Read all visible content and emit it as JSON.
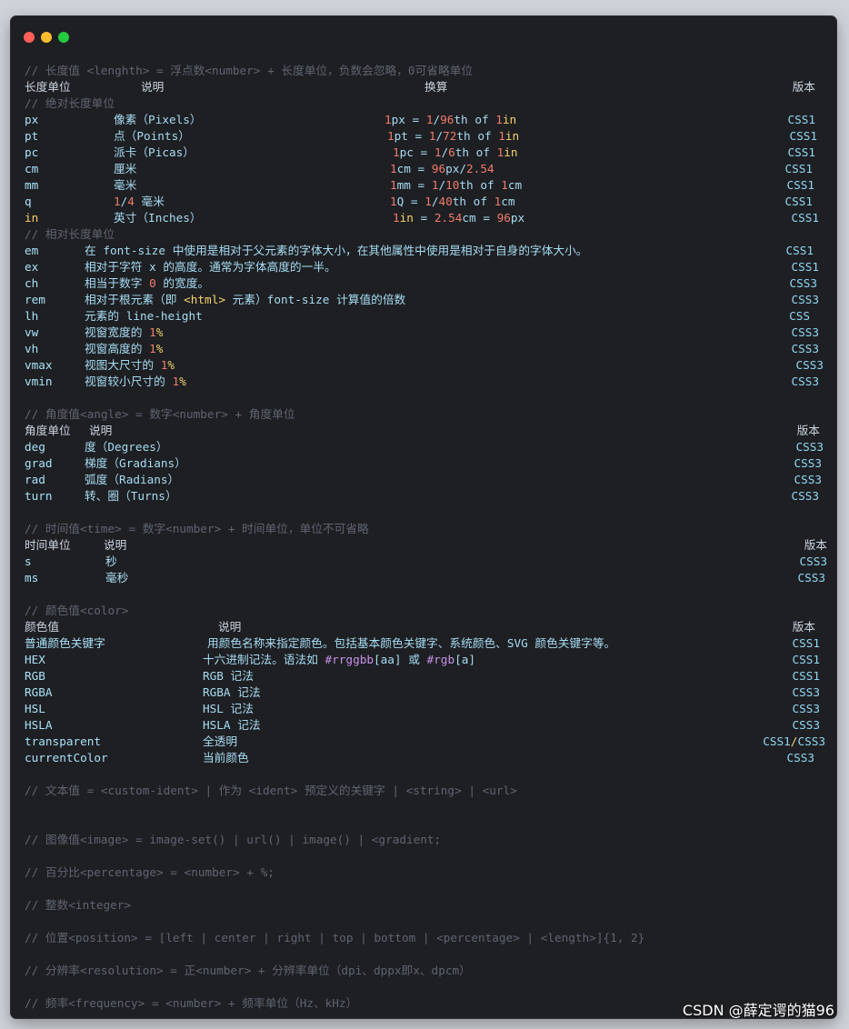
{
  "window": {
    "traffic_lights": [
      {
        "name": "close",
        "color": "#ff5f56"
      },
      {
        "name": "minimize",
        "color": "#ffbd2e"
      },
      {
        "name": "zoom",
        "color": "#27c93f"
      }
    ]
  },
  "length": {
    "comment": "// 长度值 <lenghth> = 浮点数<number> + 长度单位，负数会忽略，0可省略单位",
    "header": {
      "unit": "长度单位",
      "desc": "说明",
      "conv": "换算",
      "version": "版本"
    },
    "abs_comment": "// 绝对长度单位",
    "absolute": [
      {
        "unit": "px",
        "desc": "像素（Pixels）",
        "conv": [
          {
            "t": "1",
            "c": "n"
          },
          {
            "t": "px = ",
            "c": "tx"
          },
          {
            "t": "1",
            "c": "n"
          },
          {
            "t": "/",
            "c": "tx"
          },
          {
            "t": "96",
            "c": "n"
          },
          {
            "t": "th of ",
            "c": "tx"
          },
          {
            "t": "1",
            "c": "n"
          },
          {
            "t": "in",
            "c": "k"
          }
        ],
        "version": "CSS1"
      },
      {
        "unit": "pt",
        "desc": "点（Points）",
        "conv": [
          {
            "t": "1",
            "c": "n"
          },
          {
            "t": "pt = ",
            "c": "tx"
          },
          {
            "t": "1",
            "c": "n"
          },
          {
            "t": "/",
            "c": "tx"
          },
          {
            "t": "72",
            "c": "n"
          },
          {
            "t": "th of ",
            "c": "tx"
          },
          {
            "t": "1",
            "c": "n"
          },
          {
            "t": "in",
            "c": "k"
          }
        ],
        "version": "CSS1"
      },
      {
        "unit": "pc",
        "desc": "派卡（Picas）",
        "conv": [
          {
            "t": "1",
            "c": "n"
          },
          {
            "t": "pc = ",
            "c": "tx"
          },
          {
            "t": "1",
            "c": "n"
          },
          {
            "t": "/",
            "c": "tx"
          },
          {
            "t": "6",
            "c": "n"
          },
          {
            "t": "th of ",
            "c": "tx"
          },
          {
            "t": "1",
            "c": "n"
          },
          {
            "t": "in",
            "c": "k"
          }
        ],
        "version": "CSS1"
      },
      {
        "unit": "cm",
        "desc": "厘米",
        "conv": [
          {
            "t": "1",
            "c": "n"
          },
          {
            "t": "cm = ",
            "c": "tx"
          },
          {
            "t": "96",
            "c": "n"
          },
          {
            "t": "px",
            "c": "tx"
          },
          {
            "t": "/",
            "c": "tx"
          },
          {
            "t": "2.54",
            "c": "n"
          }
        ],
        "version": "CSS1"
      },
      {
        "unit": "mm",
        "desc": "毫米",
        "conv": [
          {
            "t": "1",
            "c": "n"
          },
          {
            "t": "mm = ",
            "c": "tx"
          },
          {
            "t": "1",
            "c": "n"
          },
          {
            "t": "/",
            "c": "tx"
          },
          {
            "t": "10",
            "c": "n"
          },
          {
            "t": "th of ",
            "c": "tx"
          },
          {
            "t": "1",
            "c": "n"
          },
          {
            "t": "cm",
            "c": "tx"
          }
        ],
        "version": "CSS1"
      },
      {
        "unit": "q",
        "desc": [
          {
            "t": "1",
            "c": "n"
          },
          {
            "t": "/",
            "c": "tx"
          },
          {
            "t": "4",
            "c": "n"
          },
          {
            "t": " 毫米",
            "c": "tx"
          }
        ],
        "conv": [
          {
            "t": "1",
            "c": "n"
          },
          {
            "t": "Q = ",
            "c": "tx"
          },
          {
            "t": "1",
            "c": "n"
          },
          {
            "t": "/",
            "c": "tx"
          },
          {
            "t": "40",
            "c": "n"
          },
          {
            "t": "th of ",
            "c": "tx"
          },
          {
            "t": "1",
            "c": "n"
          },
          {
            "t": "cm",
            "c": "tx"
          }
        ],
        "version": "CSS1"
      },
      {
        "unit": "in",
        "unit_class": "k",
        "desc": "英寸（Inches）",
        "conv": [
          {
            "t": "1",
            "c": "n"
          },
          {
            "t": "in",
            "c": "k"
          },
          {
            "t": " = ",
            "c": "tx"
          },
          {
            "t": "2.54",
            "c": "n"
          },
          {
            "t": "cm = ",
            "c": "tx"
          },
          {
            "t": "96",
            "c": "n"
          },
          {
            "t": "px",
            "c": "tx"
          }
        ],
        "version": "CSS1"
      }
    ],
    "rel_comment": "// 相对长度单位",
    "relative": [
      {
        "unit": "em",
        "desc": "在 font-size 中使用是相对于父元素的字体大小，在其他属性中使用是相对于自身的字体大小。",
        "version": "CSS1"
      },
      {
        "unit": "ex",
        "desc": "相对于字符 x 的高度。通常为字体高度的一半。",
        "version": "CSS1"
      },
      {
        "unit": "ch",
        "desc": [
          {
            "t": "相当于数字 ",
            "c": "tx"
          },
          {
            "t": "0",
            "c": "n"
          },
          {
            "t": " 的宽度。",
            "c": "tx"
          }
        ],
        "version": "CSS3"
      },
      {
        "unit": "rem",
        "desc": [
          {
            "t": "相对于根元素（即 ",
            "c": "tx"
          },
          {
            "t": "<html>",
            "c": "k"
          },
          {
            "t": " 元素）font-size 计算值的倍数",
            "c": "tx"
          }
        ],
        "version": "CSS3"
      },
      {
        "unit": "lh",
        "desc": "元素的 line-height",
        "version": "CSS"
      },
      {
        "unit": "vw",
        "desc": [
          {
            "t": "视窗宽度的 ",
            "c": "tx"
          },
          {
            "t": "1",
            "c": "n"
          },
          {
            "t": "%",
            "c": "k"
          }
        ],
        "version": "CSS3"
      },
      {
        "unit": "vh",
        "desc": [
          {
            "t": "视窗高度的 ",
            "c": "tx"
          },
          {
            "t": "1",
            "c": "n"
          },
          {
            "t": "%",
            "c": "k"
          }
        ],
        "version": "CSS3"
      },
      {
        "unit": "vmax",
        "desc": [
          {
            "t": "视图大尺寸的 ",
            "c": "tx"
          },
          {
            "t": "1",
            "c": "n"
          },
          {
            "t": "%",
            "c": "k"
          }
        ],
        "version": "CSS3"
      },
      {
        "unit": "vmin",
        "desc": [
          {
            "t": "视窗较小尺寸的 ",
            "c": "tx"
          },
          {
            "t": "1",
            "c": "n"
          },
          {
            "t": "%",
            "c": "k"
          }
        ],
        "version": "CSS3"
      }
    ]
  },
  "angle": {
    "comment": "// 角度值<angle> = 数字<number> + 角度单位",
    "header": {
      "unit": "角度单位",
      "desc": "说明",
      "version": "版本"
    },
    "rows": [
      {
        "unit": "deg",
        "desc": "度（Degrees）",
        "version": "CSS3"
      },
      {
        "unit": "grad",
        "desc": "梯度（Gradians）",
        "version": "CSS3"
      },
      {
        "unit": "rad",
        "desc": "弧度（Radians）",
        "version": "CSS3"
      },
      {
        "unit": "turn",
        "desc": "转、圈（Turns）",
        "version": "CSS3"
      }
    ]
  },
  "time": {
    "comment": "// 时间值<time> = 数字<number> + 时间单位，单位不可省略",
    "header": {
      "unit": "时间单位",
      "desc": "说明",
      "version": "版本"
    },
    "rows": [
      {
        "unit": "s",
        "desc": "秒",
        "version": "CSS3"
      },
      {
        "unit": "ms",
        "desc": "毫秒",
        "version": "CSS3"
      }
    ]
  },
  "color": {
    "comment": "// 颜色值<color>",
    "header": {
      "unit": "颜色值",
      "desc": "说明",
      "version": "版本"
    },
    "rows": [
      {
        "unit": "普通颜色关键字",
        "desc": "用颜色名称来指定颜色。包括基本颜色关键字、系统颜色、SVG 颜色关键字等。",
        "version": "CSS1"
      },
      {
        "unit": "HEX",
        "desc": [
          {
            "t": "十六进制记法。语法如 ",
            "c": "tx"
          },
          {
            "t": "#rrggbb",
            "c": "pl"
          },
          {
            "t": "[aa]",
            "c": "tx"
          },
          {
            "t": " 或 ",
            "c": "tx"
          },
          {
            "t": "#rgb",
            "c": "pl"
          },
          {
            "t": "[a]",
            "c": "tx"
          }
        ],
        "version": "CSS1"
      },
      {
        "unit": "RGB",
        "desc": "RGB 记法",
        "version": "CSS1"
      },
      {
        "unit": "RGBA",
        "desc": "RGBA 记法",
        "version": "CSS3"
      },
      {
        "unit": "HSL",
        "desc": "HSL 记法",
        "version": "CSS3"
      },
      {
        "unit": "HSLA",
        "desc": "HSLA 记法",
        "version": "CSS3"
      },
      {
        "unit": "transparent",
        "desc": "全透明",
        "version": [
          {
            "t": "CSS1",
            "c": "ve"
          },
          {
            "t": "/",
            "c": "k"
          },
          {
            "t": "CSS3",
            "c": "ve"
          }
        ]
      },
      {
        "unit": "currentColor",
        "desc": "当前颜色",
        "version": "CSS3"
      }
    ]
  },
  "comments": [
    "// 文本值 =  <custom-ident> | 作为 <ident> 预定义的关键字 | <string> | <url>",
    "// 图像值<image> = image-set() | url() | image() | <gradient;",
    "// 百分比<percentage> = <number> + %;",
    "// 整数<integer>",
    "// 位置<position> = [left | center | right | top | bottom | <percentage> | <length>]{1, 2}",
    "// 分辨率<resolution> = 正<number> + 分辨率单位（dpi、dppx即x、dpcm）",
    "// 频率<frequency> = <number> + 频率单位（Hz、kHz）"
  ],
  "watermark": "CSDN @薛定谔的猫96"
}
